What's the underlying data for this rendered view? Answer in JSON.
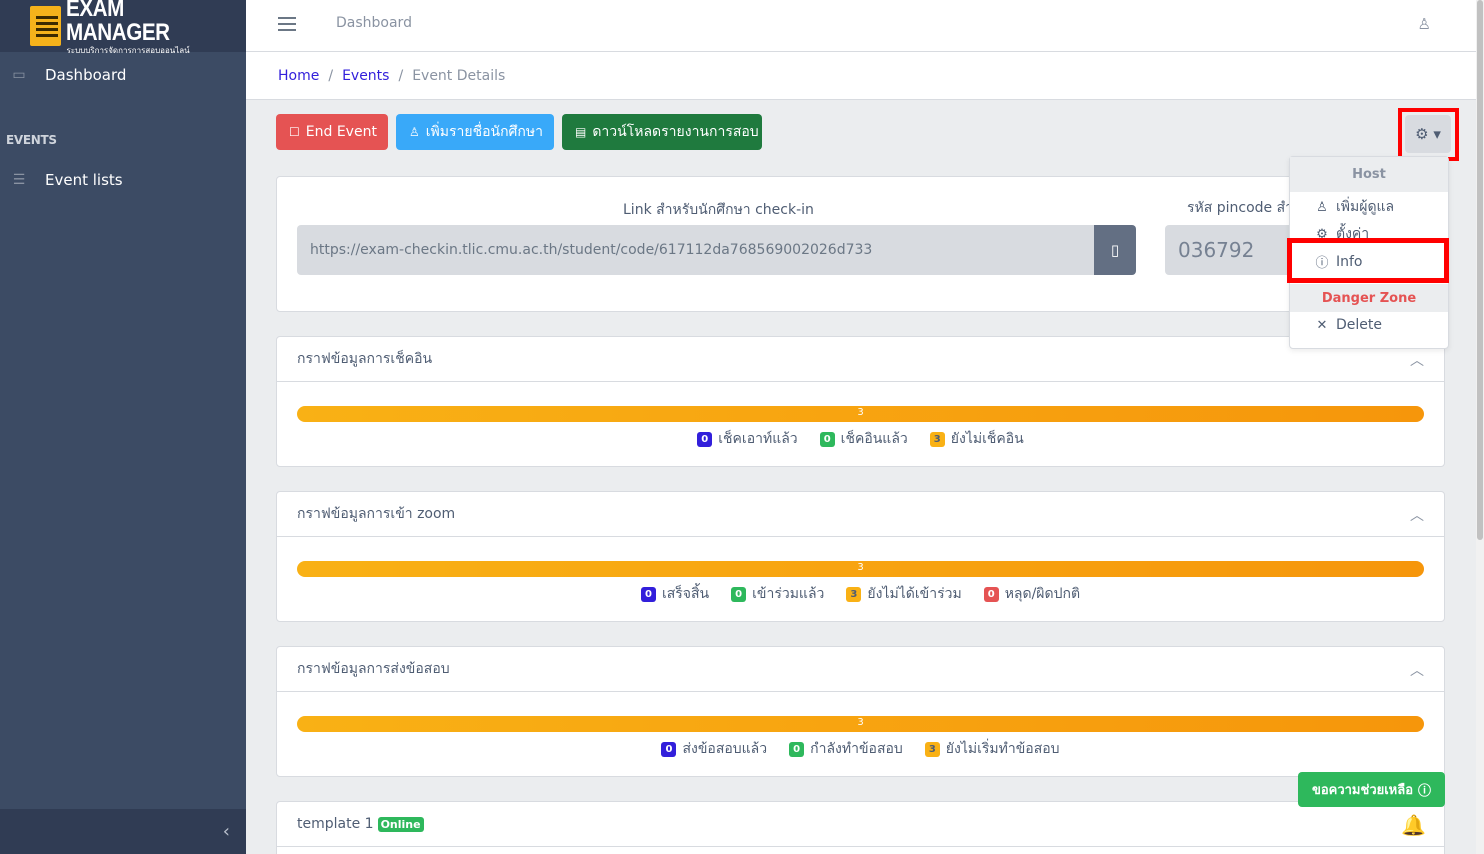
{
  "brand": {
    "title": "EXAM MANAGER",
    "subtitle": "ระบบบริการจัดการการสอบออนไลน์"
  },
  "sidebar": {
    "items": [
      {
        "label": "Dashboard",
        "icon": "laptop-icon"
      },
      {
        "label": "Event lists",
        "icon": "list-icon"
      }
    ],
    "section_title": "EVENTS"
  },
  "header": {
    "link": "Dashboard"
  },
  "breadcrumb": {
    "home": "Home",
    "events": "Events",
    "current": "Event Details",
    "separator": "/"
  },
  "actions": {
    "end_event": "End Event",
    "add_students": "เพิ่มรายชื่อนักศึกษา",
    "download_report": "ดาวน์โหลดรายงานการสอบ"
  },
  "link_card": {
    "label": "Link สำหรับนักศึกษา check-in",
    "url": "https://exam-checkin.tlic.cmu.ac.th/student/code/617112da768569002026d733",
    "pin_label": "รหัส pincode สำ",
    "pin_value": "036792"
  },
  "checkin_card": {
    "title": "กราฟข้อมูลการเช็คอิน",
    "progress_label": "3",
    "progress_fraction": 1.0,
    "legend": [
      {
        "count": "0",
        "label": "เช็คเอาท์แล้ว",
        "color": "primary"
      },
      {
        "count": "0",
        "label": "เช็คอินแล้ว",
        "color": "success"
      },
      {
        "count": "3",
        "label": "ยังไม่เช็คอิน",
        "color": "warning"
      }
    ]
  },
  "zoom_card": {
    "title": "กราฟข้อมูลการเข้า zoom",
    "progress_label": "3",
    "progress_fraction": 1.0,
    "legend": [
      {
        "count": "0",
        "label": "เสร็จสิ้น",
        "color": "primary"
      },
      {
        "count": "0",
        "label": "เข้าร่วมแล้ว",
        "color": "success"
      },
      {
        "count": "3",
        "label": "ยังไม่ได้เข้าร่วม",
        "color": "warning"
      },
      {
        "count": "0",
        "label": "หลุด/ผิดปกติ",
        "color": "danger"
      }
    ]
  },
  "submit_card": {
    "title": "กราฟข้อมูลการส่งข้อสอบ",
    "progress_label": "3",
    "progress_fraction": 1.0,
    "legend": [
      {
        "count": "0",
        "label": "ส่งข้อสอบแล้ว",
        "color": "primary"
      },
      {
        "count": "0",
        "label": "กำลังทำข้อสอบ",
        "color": "success"
      },
      {
        "count": "3",
        "label": "ยังไม่เริ่มทำข้อสอบ",
        "color": "warning"
      }
    ]
  },
  "template_card": {
    "title": "template 1",
    "badge": "Online"
  },
  "help_button": "ขอความช่วยเหลือ",
  "dropdown": {
    "host_header": "Host",
    "add_admin": "เพิ่มผู้ดูแล",
    "settings": "ตั้งค่า",
    "info": "Info",
    "danger_header": "Danger Zone",
    "delete": "Delete"
  },
  "colors": {
    "sidebar": "#3c4b64",
    "danger": "#e55353",
    "info": "#39a9f9",
    "success_dark": "#1f7a3e",
    "warning": "#f9b115",
    "highlight": "#ff0000"
  }
}
